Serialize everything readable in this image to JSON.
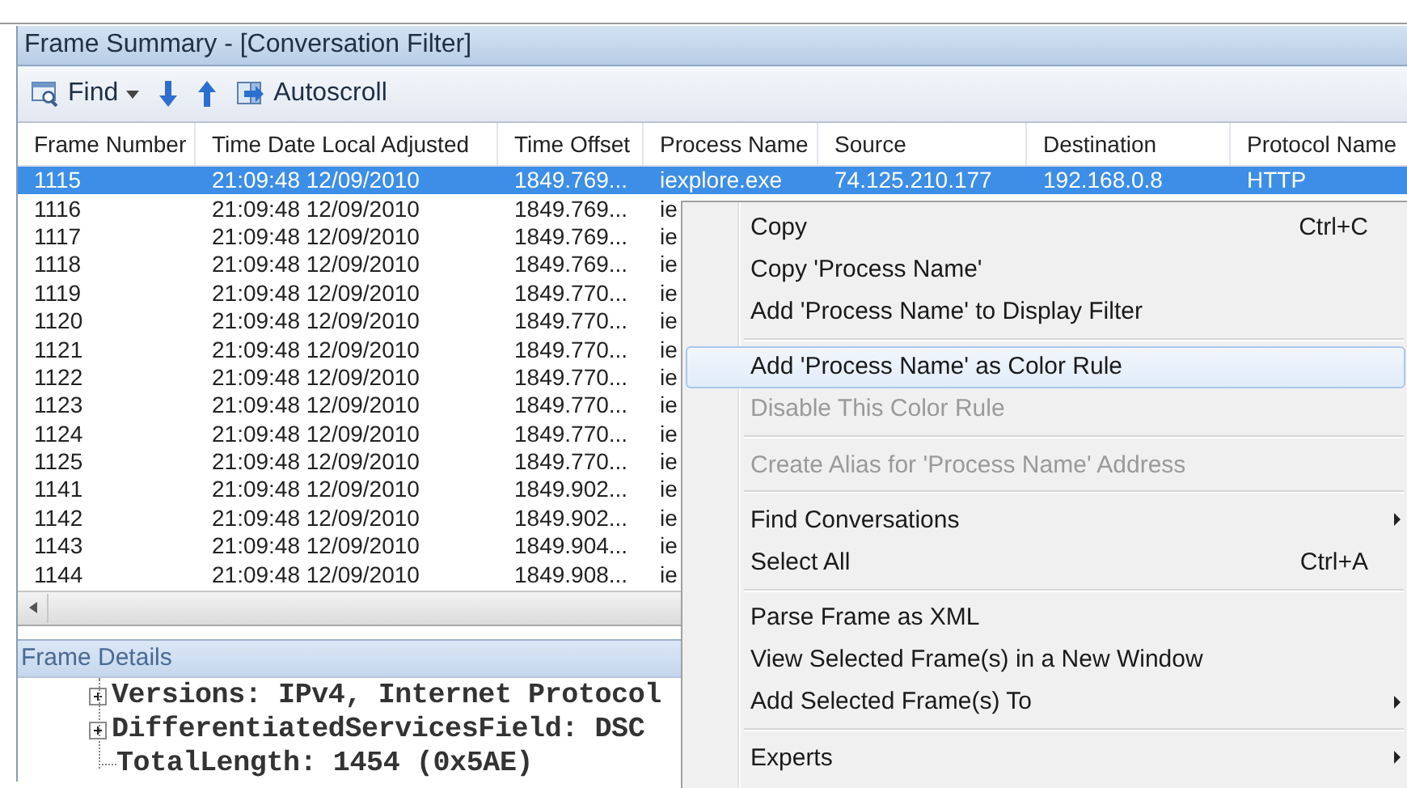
{
  "window": {
    "title": "Frame Summary - [Conversation Filter]"
  },
  "toolbar": {
    "items": [
      {
        "kind": "find",
        "label": "Find"
      },
      {
        "kind": "down"
      },
      {
        "kind": "up"
      },
      {
        "kind": "autoscroll",
        "label": "Autoscroll"
      }
    ]
  },
  "table": {
    "columns": [
      "Frame Number",
      "Time Date Local Adjusted",
      "Time Offset",
      "Process Name",
      "Source",
      "Destination",
      "Protocol Name"
    ],
    "rows": [
      {
        "selected": true,
        "cells": [
          "1115",
          "21:09:48 12/09/2010",
          "1849.769...",
          "iexplore.exe",
          "74.125.210.177",
          "192.168.0.8",
          "HTTP"
        ]
      },
      {
        "selected": false,
        "cells": [
          "1116",
          "21:09:48 12/09/2010",
          "1849.769...",
          "ie"
        ]
      },
      {
        "selected": false,
        "cells": [
          "1117",
          "21:09:48 12/09/2010",
          "1849.769...",
          "ie"
        ]
      },
      {
        "selected": false,
        "cells": [
          "1118",
          "21:09:48 12/09/2010",
          "1849.769...",
          "ie"
        ]
      },
      {
        "selected": false,
        "cells": [
          "1119",
          "21:09:48 12/09/2010",
          "1849.770...",
          "ie"
        ]
      },
      {
        "selected": false,
        "cells": [
          "1120",
          "21:09:48 12/09/2010",
          "1849.770...",
          "ie"
        ]
      },
      {
        "selected": false,
        "cells": [
          "1121",
          "21:09:48 12/09/2010",
          "1849.770...",
          "ie"
        ]
      },
      {
        "selected": false,
        "cells": [
          "1122",
          "21:09:48 12/09/2010",
          "1849.770...",
          "ie"
        ]
      },
      {
        "selected": false,
        "cells": [
          "1123",
          "21:09:48 12/09/2010",
          "1849.770...",
          "ie"
        ]
      },
      {
        "selected": false,
        "cells": [
          "1124",
          "21:09:48 12/09/2010",
          "1849.770...",
          "ie"
        ]
      },
      {
        "selected": false,
        "cells": [
          "1125",
          "21:09:48 12/09/2010",
          "1849.770...",
          "ie"
        ]
      },
      {
        "selected": false,
        "cells": [
          "1141",
          "21:09:48 12/09/2010",
          "1849.902...",
          "ie"
        ]
      },
      {
        "selected": false,
        "cells": [
          "1142",
          "21:09:48 12/09/2010",
          "1849.902...",
          "ie"
        ]
      },
      {
        "selected": false,
        "cells": [
          "1143",
          "21:09:48 12/09/2010",
          "1849.904...",
          "ie"
        ]
      },
      {
        "selected": false,
        "cells": [
          "1144",
          "21:09:48 12/09/2010",
          "1849.908...",
          "ie"
        ]
      }
    ]
  },
  "details": {
    "title": "Frame Details",
    "tree": [
      {
        "kind": "node",
        "label": "Versions: IPv4, Internet Protocol"
      },
      {
        "kind": "node",
        "label": "DifferentiatedServicesField: DSC"
      },
      {
        "kind": "leaf",
        "label": "TotalLength: 1454 (0x5AE)"
      }
    ]
  },
  "context_menu": {
    "items": [
      {
        "kind": "item",
        "label": "Copy",
        "shortcut": "Ctrl+C",
        "selected": false,
        "disabled": false,
        "submenu": false
      },
      {
        "kind": "item",
        "label": "Copy 'Process Name'",
        "selected": false,
        "disabled": false,
        "submenu": false
      },
      {
        "kind": "item",
        "label": "Add 'Process Name' to Display Filter",
        "selected": false,
        "disabled": false,
        "submenu": false
      },
      {
        "kind": "separator"
      },
      {
        "kind": "item",
        "label": "Add 'Process Name' as Color Rule",
        "selected": true,
        "disabled": false,
        "submenu": false
      },
      {
        "kind": "item",
        "label": "Disable This Color Rule",
        "selected": false,
        "disabled": true,
        "submenu": false
      },
      {
        "kind": "separator"
      },
      {
        "kind": "item",
        "label": "Create Alias for 'Process Name' Address",
        "selected": false,
        "disabled": true,
        "submenu": false
      },
      {
        "kind": "separator"
      },
      {
        "kind": "item",
        "label": "Find Conversations",
        "selected": false,
        "disabled": false,
        "submenu": true
      },
      {
        "kind": "item",
        "label": "Select All",
        "shortcut": "Ctrl+A",
        "selected": false,
        "disabled": false,
        "submenu": false
      },
      {
        "kind": "separator"
      },
      {
        "kind": "item",
        "label": "Parse Frame as XML",
        "selected": false,
        "disabled": false,
        "submenu": false
      },
      {
        "kind": "item",
        "label": "View Selected Frame(s) in a New Window",
        "selected": false,
        "disabled": false,
        "submenu": false
      },
      {
        "kind": "item",
        "label": "Add Selected Frame(s) To",
        "selected": false,
        "disabled": false,
        "submenu": true
      },
      {
        "kind": "separator"
      },
      {
        "kind": "item",
        "label": "Experts",
        "selected": false,
        "disabled": false,
        "submenu": true
      }
    ]
  }
}
